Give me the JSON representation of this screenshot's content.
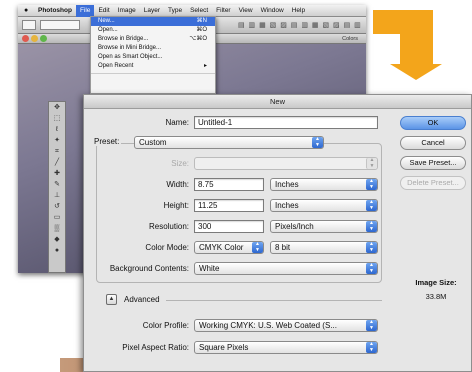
{
  "photoshop": {
    "menubar": [
      "Photoshop",
      "File",
      "Edit",
      "Image",
      "Layer",
      "Type",
      "Select",
      "Filter",
      "View",
      "Window",
      "Help"
    ],
    "active_menu": "File",
    "doc_title": "Colors"
  },
  "file_menu": {
    "items": [
      {
        "label": "New...",
        "shortcut": "⌘N",
        "highlighted": true
      },
      {
        "label": "Open...",
        "shortcut": "⌘O"
      },
      {
        "label": "Browse in Bridge...",
        "shortcut": "⌥⌘O"
      },
      {
        "label": "Browse in Mini Bridge..."
      },
      {
        "label": "Open as Smart Object..."
      },
      {
        "label": "Open Recent",
        "shortcut": "▸"
      }
    ]
  },
  "dialog": {
    "title": "New",
    "name_label": "Name:",
    "name_value": "Untitled-1",
    "preset_label": "Preset:",
    "preset_value": "Custom",
    "size_label": "Size:",
    "width_label": "Width:",
    "width_value": "8.75",
    "width_unit": "Inches",
    "height_label": "Height:",
    "height_value": "11.25",
    "height_unit": "Inches",
    "resolution_label": "Resolution:",
    "resolution_value": "300",
    "resolution_unit": "Pixels/Inch",
    "color_mode_label": "Color Mode:",
    "color_mode_value": "CMYK Color",
    "bit_depth": "8 bit",
    "background_label": "Background Contents:",
    "background_value": "White",
    "advanced_label": "Advanced",
    "color_profile_label": "Color Profile:",
    "color_profile_value": "Working CMYK:  U.S. Web Coated (S...",
    "pixel_aspect_label": "Pixel Aspect Ratio:",
    "pixel_aspect_value": "Square Pixels",
    "buttons": {
      "ok": "OK",
      "cancel": "Cancel",
      "save_preset": "Save Preset...",
      "delete_preset": "Delete Preset..."
    },
    "image_size_label": "Image Size:",
    "image_size_value": "33.8M"
  },
  "colors": {
    "accent_orange": "#f3a51b",
    "ok_button": "#5b94e6",
    "menu_highlight": "#3b6ed8"
  }
}
